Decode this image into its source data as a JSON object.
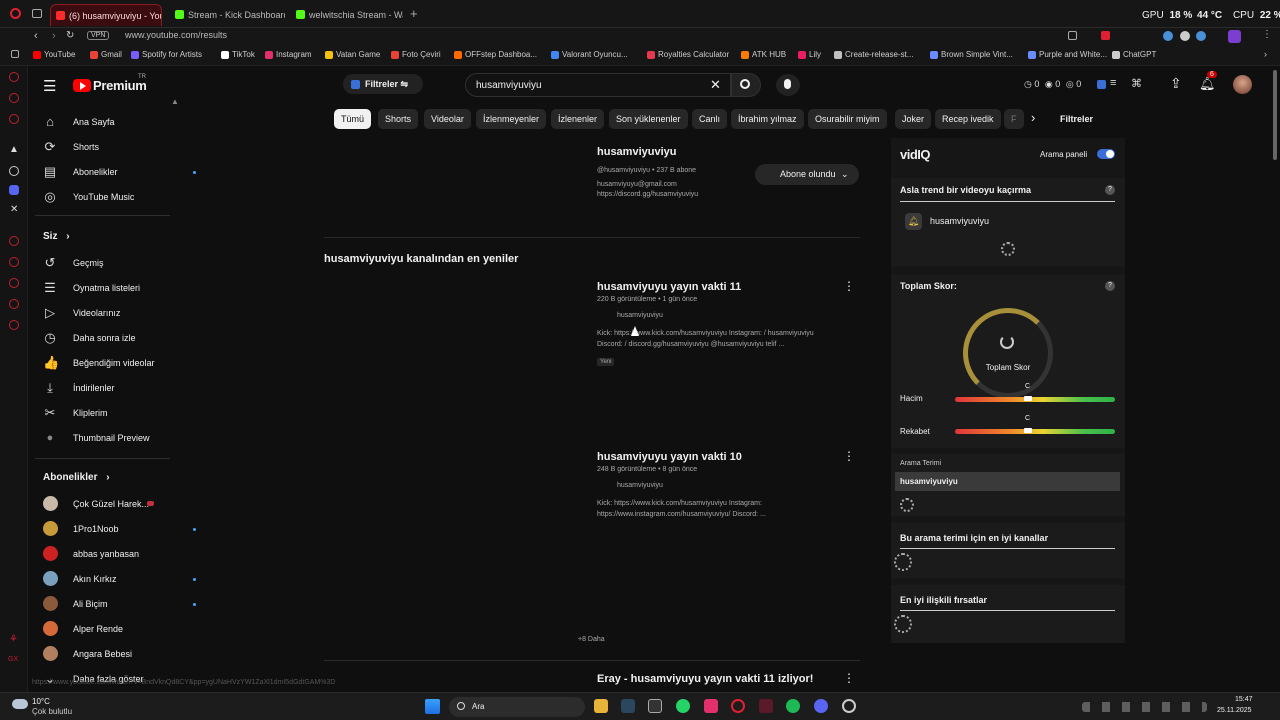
{
  "browser": {
    "tabs": [
      {
        "label": "(6) husamviyuviyu - YouT",
        "color": "#ff2a2a"
      },
      {
        "label": "Stream - Kick Dashboard",
        "color": "#53fc18"
      },
      {
        "label": "welwitschia Stream - Wat",
        "color": "#53fc18"
      }
    ],
    "url": "www.youtube.com/results",
    "vpn": "VPN",
    "gpu_label": "GPU",
    "gpu_value": "18 %",
    "gpu_temp": "44 °C",
    "cpu_label": "CPU",
    "cpu_value": "22 %",
    "bookmarks": [
      {
        "label": "YouTube",
        "color": "#ff0000"
      },
      {
        "label": "Gmail",
        "color": "#ea4335"
      },
      {
        "label": "Spotify for Artists",
        "color": "#7a5cff"
      },
      {
        "label": "TikTok",
        "color": "#ffffff"
      },
      {
        "label": "Instagram",
        "color": "#e1306c"
      },
      {
        "label": "Vatan Game",
        "color": "#f4c20d"
      },
      {
        "label": "Foto Çeviri",
        "color": "#ea4335"
      },
      {
        "label": "OFFstep Dashboa...",
        "color": "#ff6a00"
      },
      {
        "label": "Valorant Oyuncu...",
        "color": "#4285f4"
      },
      {
        "label": "Royalties Calculator",
        "color": "#e8384f"
      },
      {
        "label": "ATK HUB",
        "color": "#ff7a00"
      },
      {
        "label": "Lily",
        "color": "#e91e63"
      },
      {
        "label": "Create-release-st...",
        "color": "#c0c0c0"
      },
      {
        "label": "Brown Simple Vint...",
        "color": "#6b8cff"
      },
      {
        "label": "Purple and White...",
        "color": "#6b8cff"
      },
      {
        "label": "ChatGPT",
        "color": "#cccccc"
      }
    ]
  },
  "yt": {
    "logo": "Premium",
    "logo_sup": "TR",
    "search_value": "husamviyuviyu",
    "notif_count": "6",
    "filters_label": "Filtreler",
    "chips": [
      "Tümü",
      "Shorts",
      "Videolar",
      "İzlenmeyenler",
      "İzlenenler",
      "Son yüklenenler",
      "Canlı",
      "İbrahim yılmaz",
      "Osurabilir miyim",
      "Joker",
      "Recep ivedik",
      "F"
    ],
    "chips_filters": "Filtreler",
    "counters": [
      "0",
      "0",
      "0"
    ],
    "sidebar_main": [
      {
        "label": "Ana Sayfa",
        "icon": "⌂"
      },
      {
        "label": "Shorts",
        "icon": "⟳"
      },
      {
        "label": "Abonelikler",
        "icon": "▤"
      },
      {
        "label": "YouTube Music",
        "icon": "◎"
      }
    ],
    "you_label": "Siz",
    "sidebar_you": [
      {
        "label": "Geçmiş",
        "icon": "↺"
      },
      {
        "label": "Oynatma listeleri",
        "icon": "☰"
      },
      {
        "label": "Videolarınız",
        "icon": "▷"
      },
      {
        "label": "Daha sonra izle",
        "icon": "◷"
      },
      {
        "label": "Beğendiğim videolar",
        "icon": "👍"
      },
      {
        "label": "İndirilenler",
        "icon": "⤓"
      },
      {
        "label": "Kliplerim",
        "icon": "✂"
      },
      {
        "label": "Thumbnail Preview",
        "icon": "●"
      }
    ],
    "subs_label": "Abonelikler",
    "subs": [
      {
        "label": "Çok Güzel Harek...",
        "color": "#c9b9a8",
        "live": true
      },
      {
        "label": "1Pro1Noob",
        "color": "#c79a3a",
        "dot": true
      },
      {
        "label": "abbas yanbasan",
        "color": "#cc2222"
      },
      {
        "label": "Akın Kırkız",
        "color": "#7aa0c0",
        "dot": true
      },
      {
        "label": "Ali Biçim",
        "color": "#8b5a3a",
        "dot": true
      },
      {
        "label": "Alper Rende",
        "color": "#d46a3a"
      },
      {
        "label": "Angara Bebesi",
        "color": "#b08060"
      }
    ],
    "more_label": "Daha fazla göster",
    "channel": {
      "name": "husamviyuviyu",
      "meta": "@husamviyuviyu • 237 B abone",
      "email": "husamviyuyu@gmail.com",
      "link": "https://discord.gg/husamviyuviyu",
      "subscribed": "Abone olundu"
    },
    "section_title": "husamviyuviyu kanalından en yeniler",
    "videos": [
      {
        "title": "husamviyuyu yayın vakti 11",
        "meta": "220 B görüntüleme • 1 gün önce",
        "channel": "husamviyuviyu",
        "desc1": "Kick: https://www.kick.com/husamviyuviyu Instagram: / husamviyuviyu",
        "desc2": "Discord: / discord.gg/husamviyuviyu @husamviyuviyu telif ...",
        "badge": "Yeni"
      },
      {
        "title": "husamviyuyu yayın vakti 10",
        "meta": "248 B görüntüleme • 8 gün önce",
        "channel": "husamviyuviyu",
        "desc1": "Kick: https://www.kick.com/husamviyuviyu Instagram:",
        "desc2": "https://www.instagram.com/husamviyuviyu/ Discord: ..."
      }
    ],
    "more_count": "+8 Daha",
    "next_title": "Eray - husamviyuyu yayın vakti 11 izliyor!",
    "status_url": "https://www.youtube.com/watch?v=BndVknQd8CY&pp=ygUNaHVzYW1ZaXl1dmI5dGdtGAM%3D"
  },
  "vidiq": {
    "logo": "vidIQ",
    "panel_label": "Arama paneli",
    "trend_title": "Asla trend bir videoyu kaçırma",
    "trend_channel": "husamviyuviyu",
    "score_title": "Toplam Skor:",
    "score_label": "Toplam Skor",
    "volume_label": "Hacim",
    "competition_label": "Rekabet",
    "gauge_letter": "C",
    "volume_level": 0.45,
    "competition_level": 0.45,
    "term_label": "Arama Terimi",
    "term_value": "husamviyuviyu",
    "best_channels": "Bu arama terimi için en iyi kanallar",
    "opportunities": "En iyi ilişkili fırsatlar"
  },
  "taskbar": {
    "temp": "10°C",
    "weather": "Çok bulutlu",
    "search": "Ara",
    "time": "15:47",
    "date": "25.11.2025"
  }
}
